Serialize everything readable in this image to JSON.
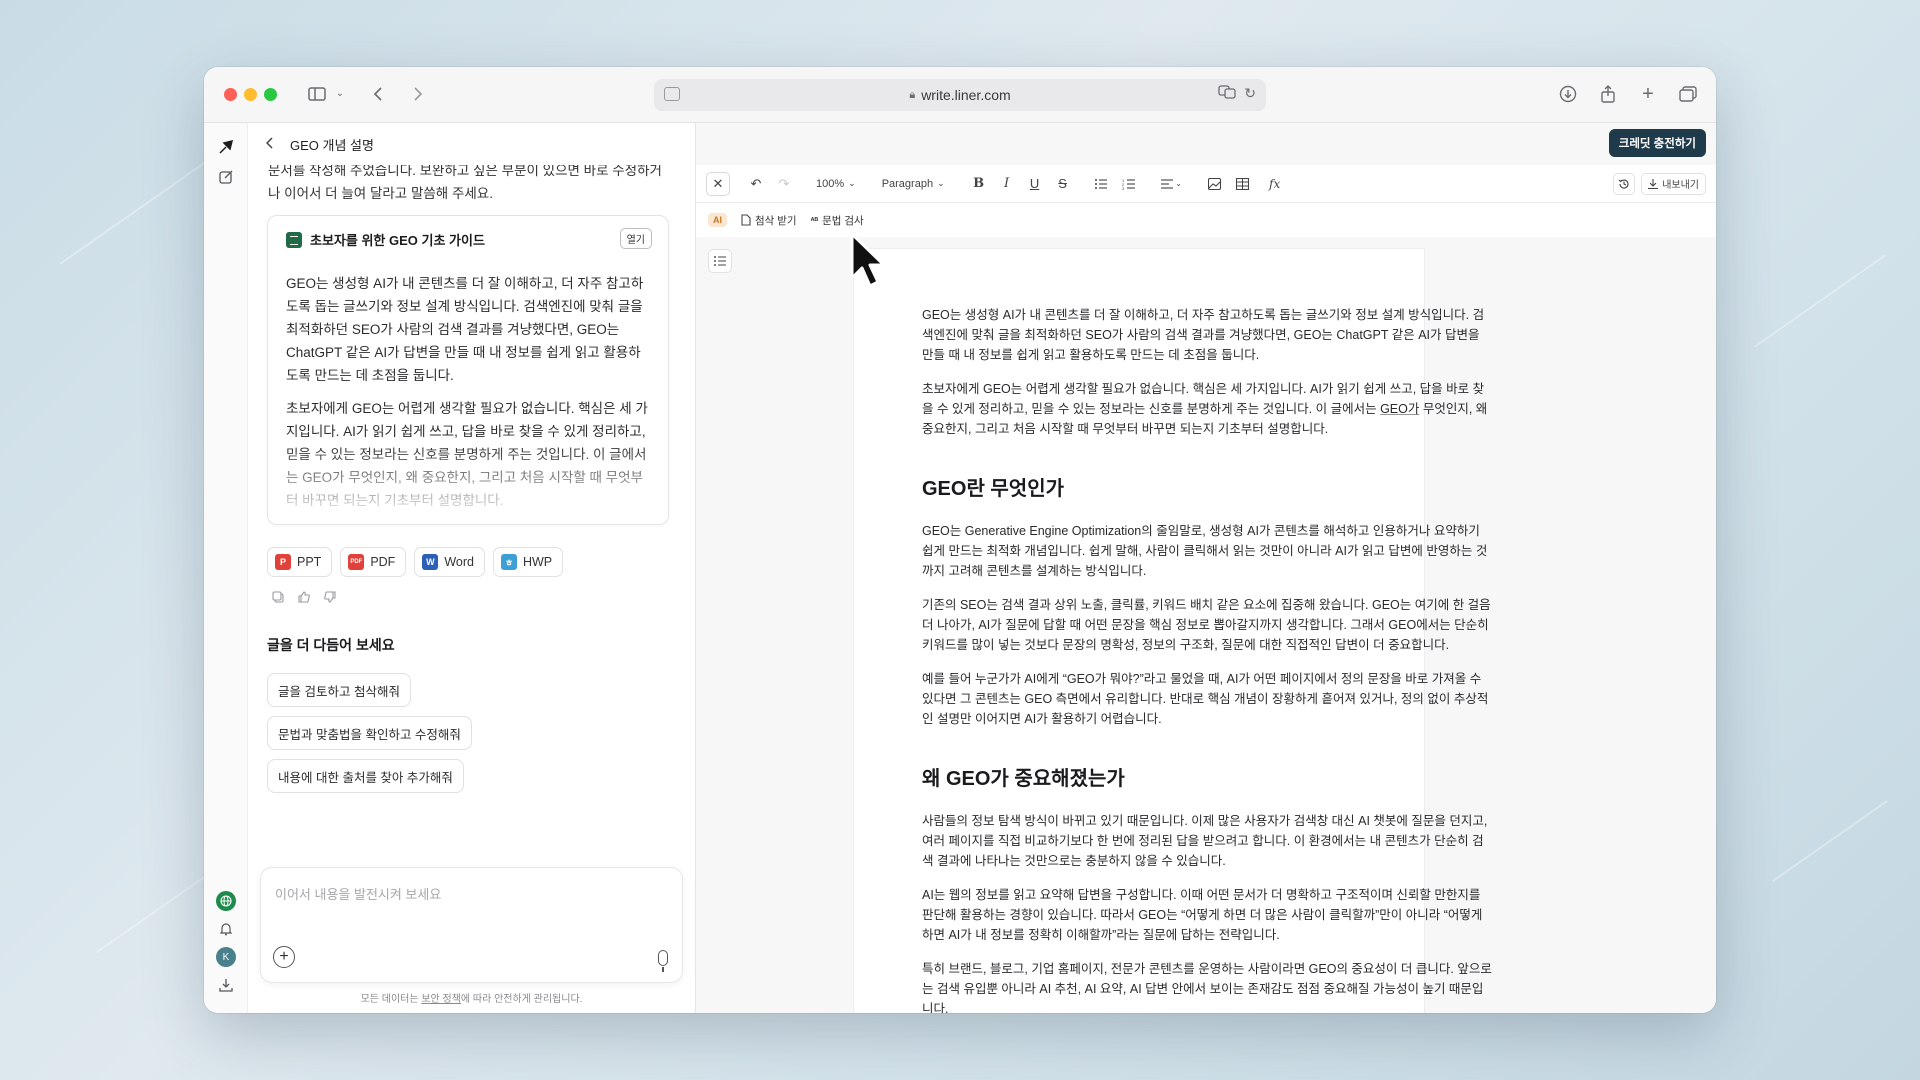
{
  "browser": {
    "url": "write.liner.com"
  },
  "left_panel": {
    "title": "GEO 개념 설명",
    "partial_message": "문서를 작성해 주었습니다. 보완하고 싶은 부분이 있으면 바로 수정하거나 이어서 더 늘여 달라고 말씀해 주세요.",
    "doc_card": {
      "title": "초보자를 위한 GEO 기초 가이드",
      "open_label": "열기",
      "paragraphs": [
        "GEO는 생성형 AI가 내 콘텐츠를 더 잘 이해하고, 더 자주 참고하도록 돕는 글쓰기와 정보 설계 방식입니다. 검색엔진에 맞춰 글을 최적화하던 SEO가 사람의 검색 결과를 겨냥했다면, GEO는 ChatGPT 같은 AI가 답변을 만들 때 내 정보를 쉽게 읽고 활용하도록 만드는 데 초점을 둡니다.",
        "초보자에게 GEO는 어렵게 생각할 필요가 없습니다. 핵심은 세 가지입니다. AI가 읽기 쉽게 쓰고, 답을 바로 찾을 수 있게 정리하고, 믿을 수 있는 정보라는 신호를 분명하게 주는 것입니다. 이 글에서는 GEO가 무엇인지, 왜 중요한지, 그리고 처음 시작할 때 무엇부터 바꾸면 되는지 기초부터 설명합니다."
      ]
    },
    "exports": [
      {
        "label": "PPT",
        "icon": "P",
        "color": "#e0413a"
      },
      {
        "label": "PDF",
        "icon": "PDF",
        "color": "#e0413a"
      },
      {
        "label": "Word",
        "icon": "W",
        "color": "#2b5fb8"
      },
      {
        "label": "HWP",
        "icon": "ㅎ",
        "color": "#3d9fd6"
      }
    ],
    "refine_title": "글을 더 다듬어 보세요",
    "suggestions": [
      "글을 검토하고 첨삭해줘",
      "문법과 맞춤법을 확인하고 수정해줘",
      "내용에 대한 출처를 찾아 추가해줘"
    ],
    "input_placeholder": "이어서 내용을 발전시켜 보세요",
    "footnote_prefix": "모든 데이터는 ",
    "footnote_link": "보안 정책",
    "footnote_suffix": "에 따라 안전하게 관리됩니다.",
    "avatar_letter": "K"
  },
  "editor": {
    "credit_button": "크레딧 충전하기",
    "zoom": "100%",
    "block_style": "Paragraph",
    "export_label": "내보내기",
    "ai_badge": "AI",
    "attach_label": "첨삭 받기",
    "grammar_label": "문법 검사",
    "content": {
      "intro_1": "GEO는 생성형 AI가 내 콘텐츠를 더 잘 이해하고, 더 자주 참고하도록 돕는 글쓰기와 정보 설계 방식입니다. 검색엔진에 맞춰 글을 최적화하던 SEO가 사람의 검색 결과를 겨냥했다면, GEO는 ChatGPT 같은 AI가 답변을 만들 때 내 정보를 쉽게 읽고 활용하도록 만드는 데 초점을 둡니다.",
      "intro_2a": "초보자에게 GEO는 어렵게 생각할 필요가 없습니다. 핵심은 세 가지입니다. AI가 읽기 쉽게 쓰고, 답을 바로 찾을 수 있게 정리하고, 믿을 수 있는 정보라는 신호를 분명하게 주는 것입니다. 이 글에서는 ",
      "intro_2b": "GEO가",
      "intro_2c": " 무엇인지, 왜 중요한지, 그리고 처음 시작할 때 무엇부터 바꾸면 되는지 기초부터 설명합니다.",
      "h1": "GEO란 무엇인가",
      "s1_p1": "GEO는 Generative Engine Optimization의 줄임말로, 생성형 AI가 콘텐츠를 해석하고 인용하거나 요약하기 쉽게 만드는 최적화 개념입니다. 쉽게 말해, 사람이 클릭해서 읽는 것만이 아니라 AI가 읽고 답변에 반영하는 것까지 고려해 콘텐츠를 설계하는 방식입니다.",
      "s1_p2": "기존의 SEO는 검색 결과 상위 노출, 클릭률, 키워드 배치 같은 요소에 집중해 왔습니다. GEO는 여기에 한 걸음 더 나아가, AI가 질문에 답할 때 어떤 문장을 핵심 정보로 뽑아갈지까지 생각합니다. 그래서 GEO에서는 단순히 키워드를 많이 넣는 것보다 문장의 명확성, 정보의 구조화, 질문에 대한 직접적인 답변이 더 중요합니다.",
      "s1_p3": "예를 들어 누군가가 AI에게 “GEO가 뭐야?”라고 물었을 때, AI가 어떤 페이지에서 정의 문장을 바로 가져올 수 있다면 그 콘텐츠는 GEO 측면에서 유리합니다. 반대로 핵심 개념이 장황하게 흩어져 있거나, 정의 없이 추상적인 설명만 이어지면 AI가 활용하기 어렵습니다.",
      "h2": "왜 GEO가 중요해졌는가",
      "s2_p1": "사람들의 정보 탐색 방식이 바뀌고 있기 때문입니다. 이제 많은 사용자가 검색창 대신 AI 챗봇에 질문을 던지고, 여러 페이지를 직접 비교하기보다 한 번에 정리된 답을 받으려고 합니다. 이 환경에서는 내 콘텐츠가 단순히 검색 결과에 나타나는 것만으로는 충분하지 않을 수 있습니다.",
      "s2_p2": "AI는 웹의 정보를 읽고 요약해 답변을 구성합니다. 이때 어떤 문서가 더 명확하고 구조적이며 신뢰할 만한지를 판단해 활용하는 경향이 있습니다. 따라서 GEO는 “어떻게 하면 더 많은 사람이 클릭할까”만이 아니라 “어떻게 하면 AI가 내 정보를 정확히 이해할까”라는 질문에 답하는 전략입니다.",
      "s2_p3": "특히 브랜드, 블로그, 기업 홈페이지, 전문가 콘텐츠를 운영하는 사람이라면 GEO의 중요성이 더 큽니다. 앞으로는 검색 유입뿐 아니라 AI 추천, AI 요약, AI 답변 안에서 보이는 존재감도 점점 중요해질 가능성이 높기 때문입니다."
    }
  }
}
